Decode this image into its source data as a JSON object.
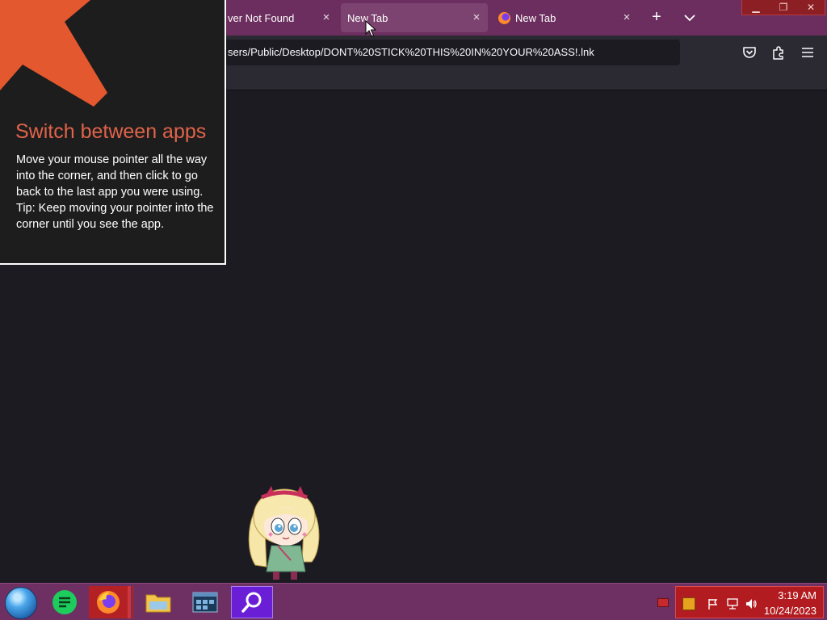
{
  "browser": {
    "tabs": [
      {
        "label": "ver Not Found",
        "active": false
      },
      {
        "label": "New Tab",
        "active": true
      },
      {
        "label": "New Tab",
        "active": false,
        "icon": "firefox-icon"
      }
    ],
    "new_tab_symbol": "+",
    "close_symbol": "×",
    "url": "sers/Public/Desktop/DONT%20STICK%20THIS%20IN%20YOUR%20ASS!.lnk",
    "window_controls": {
      "minimize": "▁",
      "restore": "❐",
      "close": "✕"
    }
  },
  "corner_tip": {
    "title": "Switch between apps",
    "body": "Move your mouse pointer all the way into the corner, and then click to go back to the last app you were using.",
    "tip": "Tip: Keep moving your pointer into the corner until you see the app."
  },
  "taskbar": {
    "apps": [
      "start-orb",
      "notes-app",
      "firefox",
      "file-explorer",
      "task-manager",
      "search"
    ],
    "clock": {
      "time": "3:19 AM",
      "date": "10/24/2023"
    }
  },
  "colors": {
    "tabbar": "#6b2e5e",
    "tip_title": "#e0634a",
    "taskbar": "#6e2f63",
    "tray": "#b21b1f"
  }
}
